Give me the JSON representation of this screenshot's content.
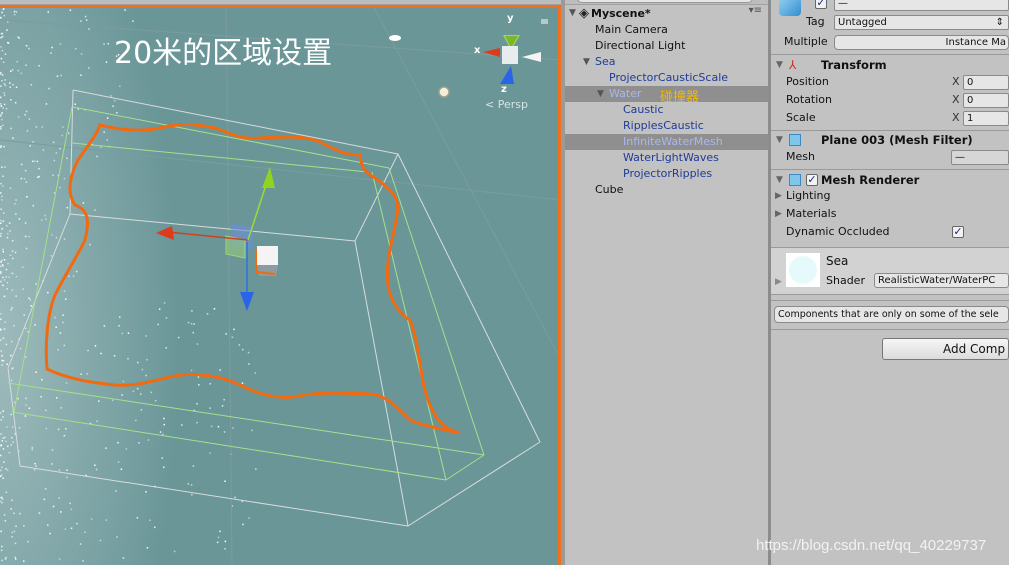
{
  "scene": {
    "caption": "20米的区域设置",
    "projection_label": "Persp",
    "gizmo_axes": {
      "y": "y",
      "x": "x",
      "z": "z"
    },
    "colors": {
      "water": "#6a9698",
      "selection_outline": "#f07020",
      "axis_x": "#e0401c",
      "axis_y": "#9cdc30",
      "axis_z": "#2a64e8"
    }
  },
  "hierarchy": {
    "scene_name": "Myscene*",
    "items": [
      {
        "label": "Main Camera",
        "depth": 0,
        "color": "black",
        "expanded": null,
        "selected": false
      },
      {
        "label": "Directional Light",
        "depth": 0,
        "color": "black",
        "expanded": null,
        "selected": false
      },
      {
        "label": "Sea",
        "depth": 0,
        "color": "blue",
        "expanded": true,
        "selected": false
      },
      {
        "label": "ProjectorCausticScale",
        "depth": 1,
        "color": "blue",
        "expanded": null,
        "selected": false
      },
      {
        "label": "Water",
        "depth": 1,
        "color": "blue",
        "expanded": true,
        "selected": true
      },
      {
        "label": "Caustic",
        "depth": 2,
        "color": "blue",
        "expanded": null,
        "selected": false
      },
      {
        "label": "RipplesCaustic",
        "depth": 2,
        "color": "blue",
        "expanded": null,
        "selected": false
      },
      {
        "label": "InfiniteWaterMesh",
        "depth": 2,
        "color": "blue",
        "expanded": null,
        "selected": true
      },
      {
        "label": "WaterLightWaves",
        "depth": 2,
        "color": "blue",
        "expanded": null,
        "selected": false
      },
      {
        "label": "ProjectorRipples",
        "depth": 2,
        "color": "blue",
        "expanded": null,
        "selected": false
      },
      {
        "label": "Cube",
        "depth": 0,
        "color": "black",
        "expanded": null,
        "selected": false
      }
    ],
    "annotation": "碰撞器"
  },
  "inspector": {
    "name_value": "—",
    "active": true,
    "tag_label": "Tag",
    "tag_value": "Untagged",
    "multiple_label": "Multiple",
    "multiple_value": "Instance Ma",
    "transform": {
      "title": "Transform",
      "rows": [
        {
          "label": "Position",
          "axis": "X",
          "value": "0"
        },
        {
          "label": "Rotation",
          "axis": "X",
          "value": "0"
        },
        {
          "label": "Scale",
          "axis": "X",
          "value": "1"
        }
      ]
    },
    "mesh_filter": {
      "title": "Plane 003 (Mesh Filter)",
      "mesh_label": "Mesh",
      "mesh_value": "—"
    },
    "mesh_renderer": {
      "title": "Mesh Renderer",
      "enabled": true,
      "lighting_label": "Lighting",
      "materials_label": "Materials",
      "dynamic_occluded_label": "Dynamic Occluded",
      "dynamic_occluded": true
    },
    "material": {
      "name": "Sea",
      "shader_label": "Shader",
      "shader_value": "RealisticWater/WaterPC"
    },
    "notice": "Components that are only on some of the sele",
    "add_component_label": "Add Comp"
  },
  "watermark": "https://blog.csdn.net/qq_40229737"
}
